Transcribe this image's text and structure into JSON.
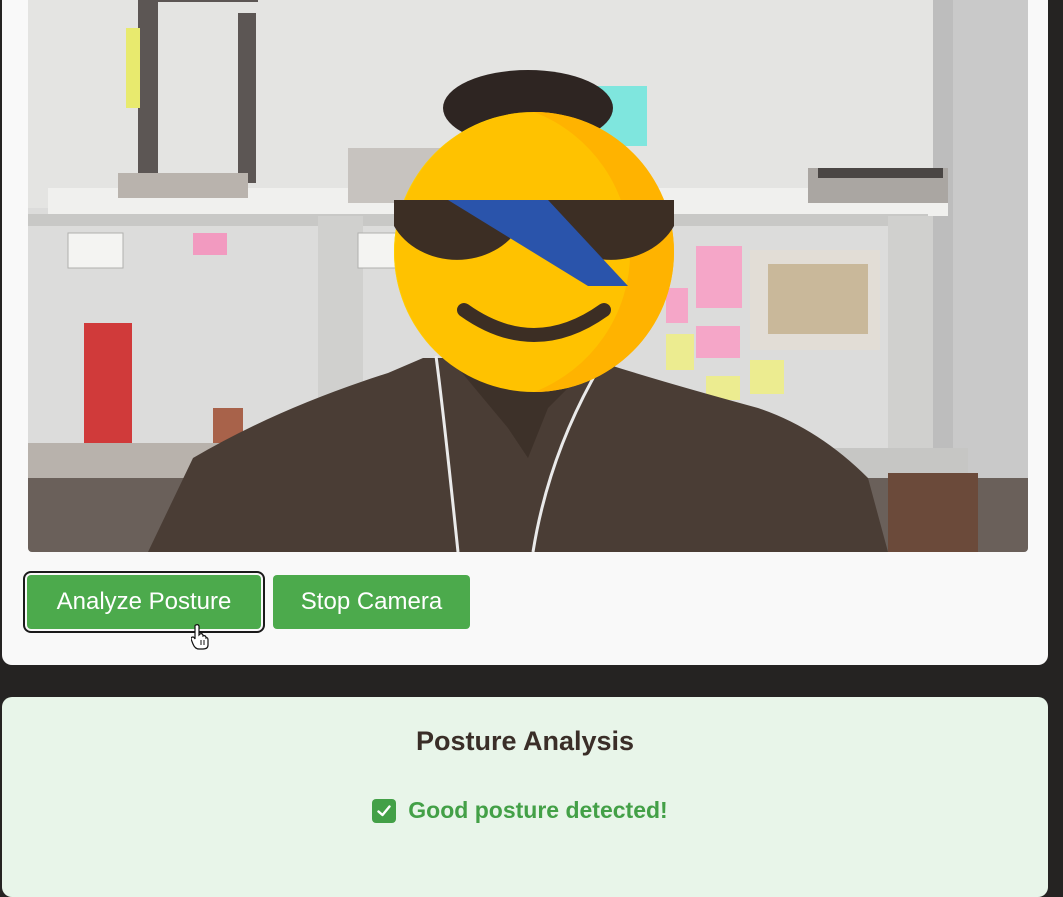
{
  "controls": {
    "analyze_label": "Analyze Posture",
    "stop_label": "Stop Camera"
  },
  "analysis": {
    "title": "Posture Analysis",
    "result_text": "Good posture detected!",
    "result_icon": "check-mark-icon",
    "result_color": "#43a047"
  },
  "video": {
    "content": "live camera feed",
    "face_overlay_icon": "sunglasses-emoji-icon"
  },
  "colors": {
    "button": "#4caa4c",
    "card_bg": "#f9f9f9",
    "result_card_bg": "#e8f5e9",
    "page_bg": "#252322"
  }
}
